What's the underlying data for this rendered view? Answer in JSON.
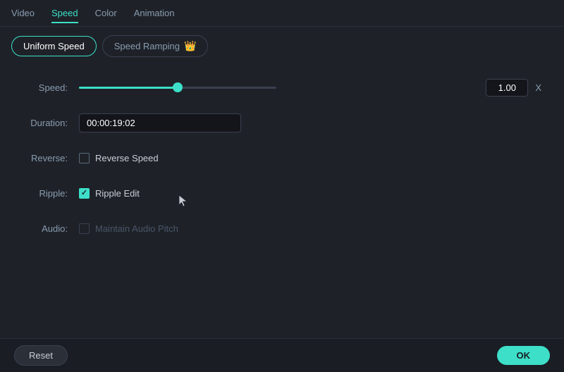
{
  "topTabs": {
    "items": [
      {
        "id": "video",
        "label": "Video",
        "active": false
      },
      {
        "id": "speed",
        "label": "Speed",
        "active": true
      },
      {
        "id": "color",
        "label": "Color",
        "active": false
      },
      {
        "id": "animation",
        "label": "Animation",
        "active": false
      }
    ]
  },
  "subTabs": {
    "items": [
      {
        "id": "uniform",
        "label": "Uniform Speed",
        "active": true,
        "hasCrown": false
      },
      {
        "id": "ramping",
        "label": "Speed Ramping",
        "active": false,
        "hasCrown": true
      }
    ]
  },
  "form": {
    "speedLabel": "Speed:",
    "speedValue": "1.00",
    "speedXLabel": "X",
    "durationLabel": "Duration:",
    "durationValue": "00:00:19:02",
    "reverseLabel": "Reverse:",
    "reverseCheckLabel": "Reverse Speed",
    "reverseChecked": false,
    "rippleLabel": "Ripple:",
    "rippleCheckLabel": "Ripple Edit",
    "rippleChecked": true,
    "audioLabel": "Audio:",
    "audioCheckLabel": "Maintain Audio Pitch",
    "audioChecked": false,
    "audioDisabled": true
  },
  "bottomBar": {
    "resetLabel": "Reset",
    "okLabel": "OK"
  }
}
